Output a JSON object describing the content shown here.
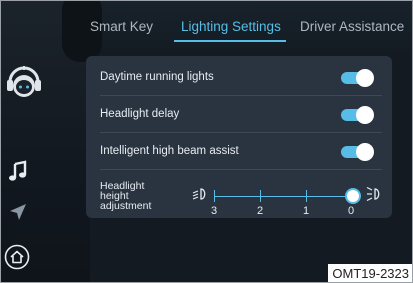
{
  "tabs": [
    {
      "label": "Smart Key",
      "active": false
    },
    {
      "label": "Lighting Settings",
      "active": true
    },
    {
      "label": "Driver Assistance",
      "active": false
    }
  ],
  "settings": [
    {
      "label": "Daytime running lights",
      "enabled": true
    },
    {
      "label": "Headlight delay",
      "enabled": true
    },
    {
      "label": "Intelligent high beam assist",
      "enabled": true
    }
  ],
  "headlight_height": {
    "label_lines": [
      "Headlight",
      "height",
      "adjustment"
    ],
    "ticks": [
      "3",
      "2",
      "1",
      "0"
    ],
    "value": "0"
  },
  "sidebar_icons": [
    "robot-avatar-icon",
    "music-icon",
    "navigation-icon",
    "home-icon"
  ],
  "code": "OMT19-2323",
  "colors": {
    "accent": "#57bde6",
    "panel": "#2a3440",
    "background": "#131a21"
  }
}
